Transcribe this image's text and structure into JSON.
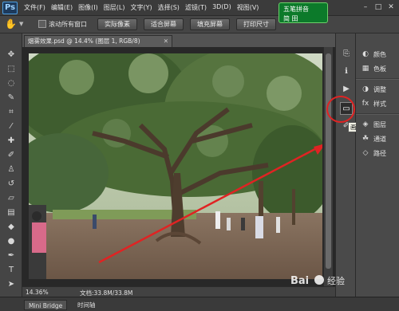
{
  "app": {
    "logo": "Ps"
  },
  "menu": {
    "items": [
      "文件(F)",
      "编辑(E)",
      "图像(I)",
      "图层(L)",
      "文字(Y)",
      "选择(S)",
      "滤镜(T)",
      "3D(D)",
      "视图(V)"
    ]
  },
  "ime": {
    "line1": "五笔拼音",
    "line2": "简 田"
  },
  "options": {
    "scroll_all_label": "滚动所有窗口",
    "buttons": [
      "实际像素",
      "适合屏幕",
      "填充屏幕",
      "打印尺寸"
    ]
  },
  "document": {
    "tab_title": "烟雾效果.psd @ 14.4% (图层 1, RGB/8)"
  },
  "status": {
    "zoom": "14.36%",
    "doc_info": "文档:33.8M/33.8M"
  },
  "bottom_tabs": [
    "Mini Bridge",
    "时间轴"
  ],
  "tooltip": {
    "text": "画笔预设"
  },
  "right_panels": [
    {
      "icon": "color-icon",
      "label": "颜色"
    },
    {
      "icon": "swatches-icon",
      "label": "色板"
    },
    {
      "icon": "adjustments-icon",
      "label": "调整"
    },
    {
      "icon": "styles-icon",
      "label": "样式"
    },
    {
      "icon": "layers-icon",
      "label": "图层"
    },
    {
      "icon": "channels-icon",
      "label": "通道"
    },
    {
      "icon": "paths-icon",
      "label": "路径"
    }
  ],
  "watermark": {
    "text": "Bai 经验"
  },
  "colors": {
    "annotation_red": "#e02323",
    "ime_green": "#0c7a2a",
    "ps_blue": "#4d9ee0"
  }
}
